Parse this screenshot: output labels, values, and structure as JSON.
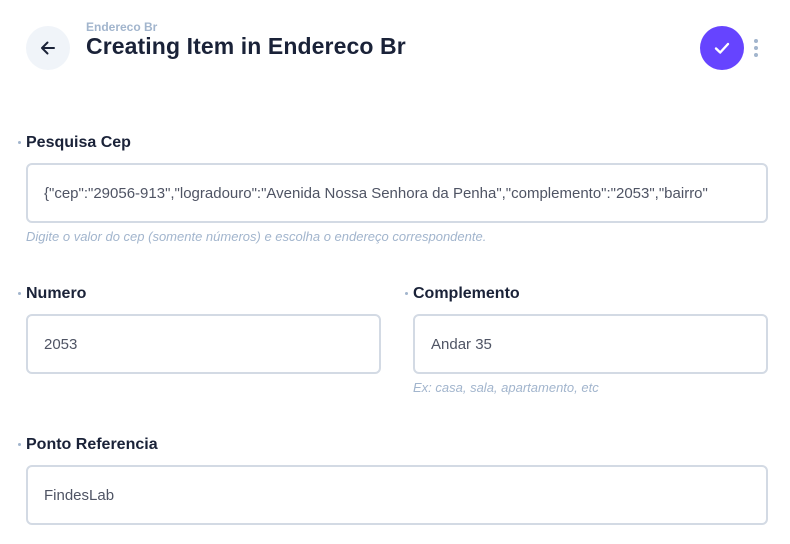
{
  "header": {
    "breadcrumb": "Endereco Br",
    "title": "Creating Item in Endereco Br",
    "back_icon": "arrow-left-icon",
    "save_icon": "check-icon",
    "more_icon": "more-vertical-icon",
    "accent_color": "#6644ff"
  },
  "fields": {
    "pesquisa_cep": {
      "label": "Pesquisa Cep",
      "value": "{\"cep\":\"29056-913\",\"logradouro\":\"Avenida Nossa Senhora da Penha\",\"complemento\":\"2053\",\"bairro\"",
      "hint": "Digite o valor do cep (somente números) e escolha o endereço correspondente."
    },
    "numero": {
      "label": "Numero",
      "value": "2053"
    },
    "complemento": {
      "label": "Complemento",
      "value": "Andar 35",
      "hint": "Ex: casa, sala, apartamento, etc"
    },
    "ponto_referencia": {
      "label": "Ponto Referencia",
      "value": "FindesLab"
    }
  }
}
